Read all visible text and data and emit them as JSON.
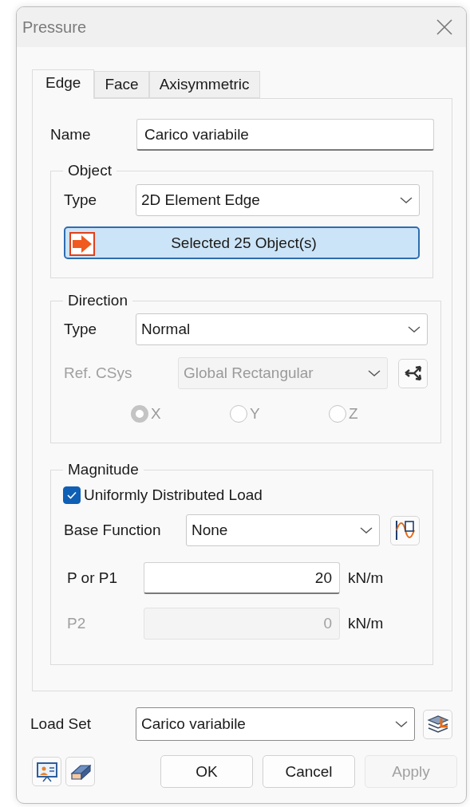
{
  "window": {
    "title": "Pressure"
  },
  "tabs": [
    {
      "label": "Edge",
      "selected": true
    },
    {
      "label": "Face",
      "selected": false
    },
    {
      "label": "Axisymmetric",
      "selected": false
    }
  ],
  "name": {
    "label": "Name",
    "value": "Carico variabile"
  },
  "object": {
    "title": "Object",
    "type": {
      "label": "Type",
      "value": "2D Element Edge"
    },
    "selection_button": "Selected 25 Object(s)"
  },
  "direction": {
    "title": "Direction",
    "type": {
      "label": "Type",
      "value": "Normal"
    },
    "ref_csys": {
      "label": "Ref. CSys",
      "value": "Global Rectangular",
      "disabled": true
    },
    "axes": [
      {
        "label": "X",
        "selected": true,
        "disabled": true
      },
      {
        "label": "Y",
        "selected": false,
        "disabled": true
      },
      {
        "label": "Z",
        "selected": false,
        "disabled": true
      }
    ]
  },
  "magnitude": {
    "title": "Magnitude",
    "uniform": {
      "label": "Uniformly Distributed Load",
      "checked": true
    },
    "base_function": {
      "label": "Base Function",
      "value": "None"
    },
    "fields": [
      {
        "label": "P or P1",
        "value": "20",
        "unit": "kN/m",
        "disabled": false
      },
      {
        "label": "P2",
        "value": "0",
        "unit": "kN/m",
        "disabled": true
      }
    ]
  },
  "load_set": {
    "label": "Load Set",
    "value": "Carico variabile"
  },
  "buttons": [
    {
      "label": "OK",
      "disabled": false
    },
    {
      "label": "Cancel",
      "disabled": false
    },
    {
      "label": "Apply",
      "disabled": true
    }
  ]
}
